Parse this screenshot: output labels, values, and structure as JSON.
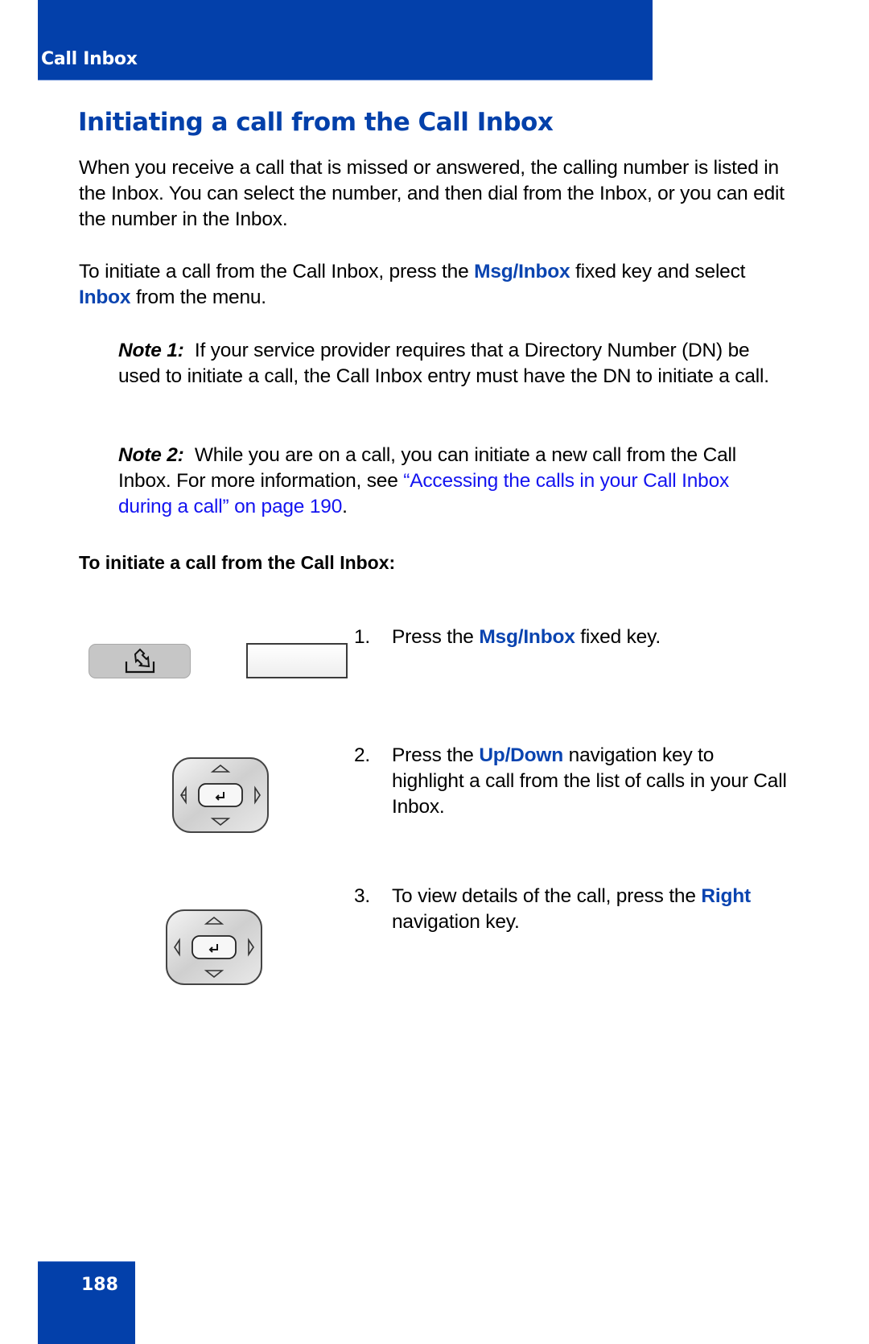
{
  "header": {
    "section_label": "Call Inbox",
    "color": "#0340aa"
  },
  "title": "Initiating a call from the Call Inbox",
  "intro": {
    "paragraph1": "When you receive a call that is missed or answered, the calling number is listed in the Inbox. You can select the number, and then dial from the Inbox, or you can edit the number in the Inbox.",
    "paragraph2": {
      "t1": "To initiate a call from the Call Inbox, press the ",
      "key1": "Msg/Inbox",
      "t2": " fixed key and select ",
      "key2": "Inbox",
      "t3": " from the menu."
    }
  },
  "notes": [
    {
      "label": "Note 1:",
      "text": "If your service provider requires that a Directory Number (DN) be used to initiate a call, the Call Inbox entry must have the DN to initiate a call."
    },
    {
      "label": "Note 2:",
      "text": "While you are on a call, you can initiate a new call from the Call Inbox. For more information, see ",
      "link": "“Accessing the calls in your Call Inbox during a call” on page 190",
      "after": "."
    }
  ],
  "procedure": {
    "heading": "To initiate a call from the Call Inbox:",
    "steps": [
      {
        "num": "1.",
        "t1": "Press the ",
        "key": "Msg/Inbox",
        "t2": " fixed key.",
        "icons": [
          "msg-inbox-key",
          "blank-softkey"
        ]
      },
      {
        "num": "2.",
        "t1": "Press the ",
        "key": "Up/Down",
        "t2": " navigation key to highlight a call from the list of calls in your Call Inbox.",
        "icons": [
          "navigation-key"
        ]
      },
      {
        "num": "3.",
        "t1": "To view details of the call, press the ",
        "key": "Right",
        "t2": " navigation key.",
        "icons": [
          "navigation-key"
        ]
      }
    ]
  },
  "footer": {
    "page_number": "188"
  },
  "colors": {
    "brand_blue": "#0340aa",
    "keyword_blue": "#0a44b0",
    "link_blue": "#1414f0"
  }
}
